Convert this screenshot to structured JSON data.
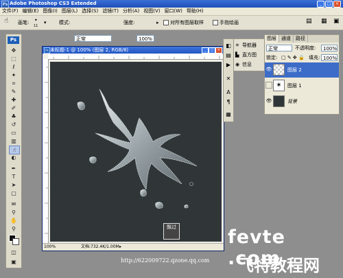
{
  "app": {
    "title": "Adobe Photoshop CS3 Extended"
  },
  "menu": [
    "文件(F)",
    "编辑(E)",
    "图像(I)",
    "图层(L)",
    "选择(S)",
    "滤镜(T)",
    "分析(A)",
    "视图(V)",
    "窗口(W)",
    "帮助(H)"
  ],
  "options": {
    "brush_label": "画笔:",
    "brush_size": "11",
    "mode_label": "模式:",
    "mode_value": "正常",
    "strength_label": "强度:",
    "strength_value": "100%",
    "sample_all_label": "对所有图层取样",
    "finger_paint_label": "手指绘画"
  },
  "document": {
    "title": "未标题-1 @ 100% (图层 2, RGB/8)",
    "zoom": "100%",
    "doc_info": "文档:732.4K/1.00M"
  },
  "nav_panel": {
    "items": [
      {
        "label": "导航器",
        "icon": "navigator-icon"
      },
      {
        "label": "直方图",
        "icon": "histogram-icon"
      },
      {
        "label": "信息",
        "icon": "info-icon"
      }
    ]
  },
  "layers_panel": {
    "tabs": [
      "图层",
      "通道",
      "路径"
    ],
    "blend_mode": "正常",
    "opacity_label": "不透明度:",
    "opacity_value": "100%",
    "lock_label": "锁定:",
    "fill_label": "填充:",
    "fill_value": "100%",
    "layers": [
      {
        "name": "图层 2",
        "selected": true,
        "visible": true
      },
      {
        "name": "图层 1",
        "selected": false,
        "visible": false
      },
      {
        "name": "背景",
        "selected": false,
        "visible": true
      }
    ]
  },
  "watermark": {
    "line1": "fevte .com",
    "line2": "飞特教程网",
    "url": "http://622009722.qzone.qq.com",
    "seal_text": "飘过"
  }
}
